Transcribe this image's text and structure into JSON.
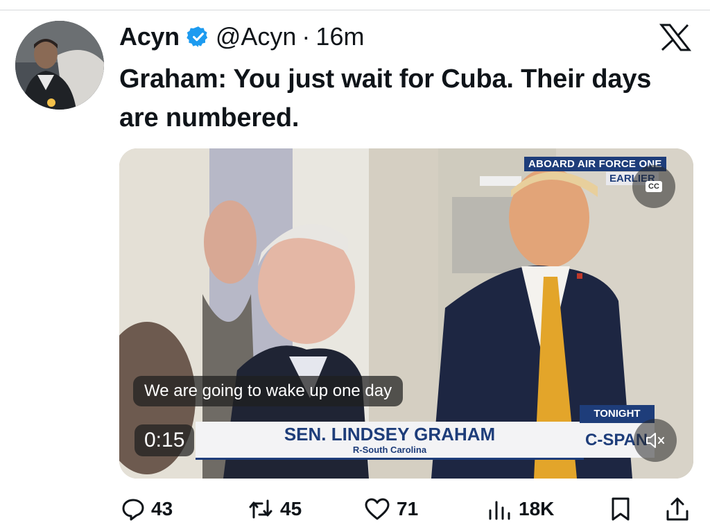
{
  "post": {
    "author_name": "Acyn",
    "handle": "@Acyn",
    "separator": "·",
    "time": "16m",
    "text": "Graham: You just wait for Cuba. Their days are numbered."
  },
  "video": {
    "top_banner": "ABOARD AIR FORCE ONE",
    "top_banner_sub": "EARLIER",
    "cc_label": "CC",
    "caption": "We are going to wake up one day",
    "lower_third_name": "SEN. LINDSEY GRAHAM",
    "lower_third_sub": "R-South Carolina",
    "duration": "0:15",
    "network_tag": "TONIGHT",
    "network": "C-SPAN",
    "colors": {
      "banner": "#1e3d7a",
      "tie": "#e3a52a"
    }
  },
  "actions": {
    "replies": "43",
    "reposts": "45",
    "likes": "71",
    "views": "18K"
  },
  "icons": [
    "verified-badge-icon",
    "x-logo-icon",
    "closed-captions-icon",
    "mute-icon",
    "reply-icon",
    "repost-icon",
    "like-icon",
    "views-icon",
    "bookmark-icon",
    "share-icon"
  ],
  "colors": {
    "verified": "#1d9bf0",
    "text": "#0f1419"
  }
}
